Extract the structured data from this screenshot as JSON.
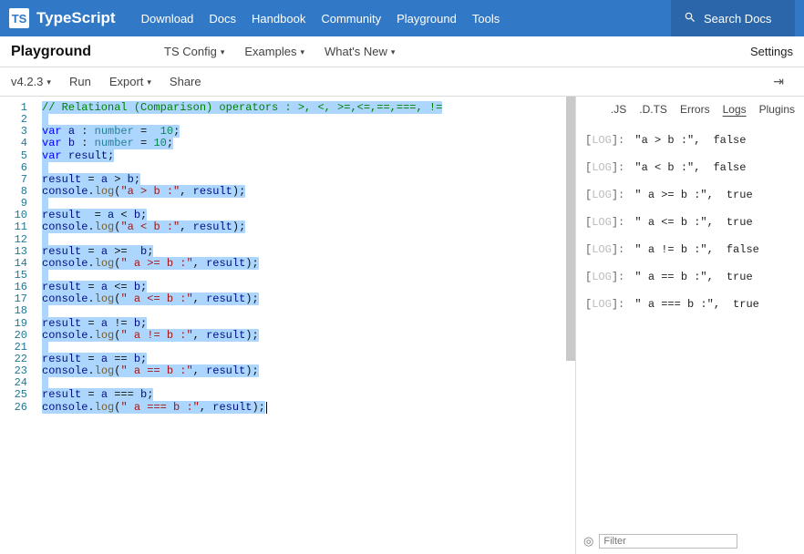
{
  "topbar": {
    "logo_text": "TS",
    "brand": "TypeScript",
    "links": [
      "Download",
      "Docs",
      "Handbook",
      "Community",
      "Playground",
      "Tools"
    ],
    "search_placeholder": "Search Docs"
  },
  "subbar": {
    "page_title": "Playground",
    "items": [
      "TS Config",
      "Examples",
      "What's New"
    ],
    "settings": "Settings"
  },
  "toolbar": {
    "version": "v4.2.3",
    "run": "Run",
    "export": "Export",
    "share": "Share"
  },
  "editor": {
    "lines": [
      {
        "n": 1,
        "tokens": [
          {
            "t": "// Relational (Comparison) operators : >, <, >=,<=,==,===, !=",
            "c": "tok-comment"
          }
        ]
      },
      {
        "n": 2,
        "tokens": []
      },
      {
        "n": 3,
        "tokens": [
          {
            "t": "var",
            "c": "tok-kw"
          },
          {
            "t": " "
          },
          {
            "t": "a",
            "c": "tok-ident"
          },
          {
            "t": " : "
          },
          {
            "t": "number",
            "c": "tok-type"
          },
          {
            "t": " =  "
          },
          {
            "t": "10",
            "c": "tok-num"
          },
          {
            "t": ";"
          }
        ]
      },
      {
        "n": 4,
        "tokens": [
          {
            "t": "var",
            "c": "tok-kw"
          },
          {
            "t": " "
          },
          {
            "t": "b",
            "c": "tok-ident"
          },
          {
            "t": " : "
          },
          {
            "t": "number",
            "c": "tok-type"
          },
          {
            "t": " = "
          },
          {
            "t": "10",
            "c": "tok-num"
          },
          {
            "t": ";"
          }
        ]
      },
      {
        "n": 5,
        "tokens": [
          {
            "t": "var",
            "c": "tok-kw"
          },
          {
            "t": " "
          },
          {
            "t": "result",
            "c": "tok-ident"
          },
          {
            "t": ";"
          }
        ]
      },
      {
        "n": 6,
        "tokens": []
      },
      {
        "n": 7,
        "tokens": [
          {
            "t": "result",
            "c": "tok-ident"
          },
          {
            "t": " = "
          },
          {
            "t": "a",
            "c": "tok-ident"
          },
          {
            "t": " > "
          },
          {
            "t": "b",
            "c": "tok-ident"
          },
          {
            "t": ";"
          }
        ]
      },
      {
        "n": 8,
        "tokens": [
          {
            "t": "console",
            "c": "tok-ident"
          },
          {
            "t": "."
          },
          {
            "t": "log",
            "c": "tok-fn"
          },
          {
            "t": "("
          },
          {
            "t": "\"a > b :\"",
            "c": "tok-str"
          },
          {
            "t": ", "
          },
          {
            "t": "result",
            "c": "tok-ident"
          },
          {
            "t": ");"
          }
        ]
      },
      {
        "n": 9,
        "tokens": []
      },
      {
        "n": 10,
        "tokens": [
          {
            "t": "result",
            "c": "tok-ident"
          },
          {
            "t": "  = "
          },
          {
            "t": "a",
            "c": "tok-ident"
          },
          {
            "t": " < "
          },
          {
            "t": "b",
            "c": "tok-ident"
          },
          {
            "t": ";"
          }
        ]
      },
      {
        "n": 11,
        "tokens": [
          {
            "t": "console",
            "c": "tok-ident"
          },
          {
            "t": "."
          },
          {
            "t": "log",
            "c": "tok-fn"
          },
          {
            "t": "("
          },
          {
            "t": "\"a < b :\"",
            "c": "tok-str"
          },
          {
            "t": ", "
          },
          {
            "t": "result",
            "c": "tok-ident"
          },
          {
            "t": ");"
          }
        ]
      },
      {
        "n": 12,
        "tokens": []
      },
      {
        "n": 13,
        "tokens": [
          {
            "t": "result",
            "c": "tok-ident"
          },
          {
            "t": " = "
          },
          {
            "t": "a",
            "c": "tok-ident"
          },
          {
            "t": " >=  "
          },
          {
            "t": "b",
            "c": "tok-ident"
          },
          {
            "t": ";"
          }
        ]
      },
      {
        "n": 14,
        "tokens": [
          {
            "t": "console",
            "c": "tok-ident"
          },
          {
            "t": "."
          },
          {
            "t": "log",
            "c": "tok-fn"
          },
          {
            "t": "("
          },
          {
            "t": "\" a >= b :\"",
            "c": "tok-str"
          },
          {
            "t": ", "
          },
          {
            "t": "result",
            "c": "tok-ident"
          },
          {
            "t": ");"
          }
        ]
      },
      {
        "n": 15,
        "tokens": []
      },
      {
        "n": 16,
        "tokens": [
          {
            "t": "result",
            "c": "tok-ident"
          },
          {
            "t": " = "
          },
          {
            "t": "a",
            "c": "tok-ident"
          },
          {
            "t": " <= "
          },
          {
            "t": "b",
            "c": "tok-ident"
          },
          {
            "t": ";"
          }
        ]
      },
      {
        "n": 17,
        "tokens": [
          {
            "t": "console",
            "c": "tok-ident"
          },
          {
            "t": "."
          },
          {
            "t": "log",
            "c": "tok-fn"
          },
          {
            "t": "("
          },
          {
            "t": "\" a <= b :\"",
            "c": "tok-str"
          },
          {
            "t": ", "
          },
          {
            "t": "result",
            "c": "tok-ident"
          },
          {
            "t": ");"
          }
        ]
      },
      {
        "n": 18,
        "tokens": []
      },
      {
        "n": 19,
        "tokens": [
          {
            "t": "result",
            "c": "tok-ident"
          },
          {
            "t": " = "
          },
          {
            "t": "a",
            "c": "tok-ident"
          },
          {
            "t": " != "
          },
          {
            "t": "b",
            "c": "tok-ident"
          },
          {
            "t": ";"
          }
        ]
      },
      {
        "n": 20,
        "tokens": [
          {
            "t": "console",
            "c": "tok-ident"
          },
          {
            "t": "."
          },
          {
            "t": "log",
            "c": "tok-fn"
          },
          {
            "t": "("
          },
          {
            "t": "\" a != b :\"",
            "c": "tok-str"
          },
          {
            "t": ", "
          },
          {
            "t": "result",
            "c": "tok-ident"
          },
          {
            "t": ");"
          }
        ]
      },
      {
        "n": 21,
        "tokens": []
      },
      {
        "n": 22,
        "tokens": [
          {
            "t": "result",
            "c": "tok-ident"
          },
          {
            "t": " = "
          },
          {
            "t": "a",
            "c": "tok-ident"
          },
          {
            "t": " == "
          },
          {
            "t": "b",
            "c": "tok-ident"
          },
          {
            "t": ";"
          }
        ]
      },
      {
        "n": 23,
        "tokens": [
          {
            "t": "console",
            "c": "tok-ident"
          },
          {
            "t": "."
          },
          {
            "t": "log",
            "c": "tok-fn"
          },
          {
            "t": "("
          },
          {
            "t": "\" a == b :\"",
            "c": "tok-str"
          },
          {
            "t": ", "
          },
          {
            "t": "result",
            "c": "tok-ident"
          },
          {
            "t": ");"
          }
        ]
      },
      {
        "n": 24,
        "tokens": []
      },
      {
        "n": 25,
        "tokens": [
          {
            "t": "result",
            "c": "tok-ident"
          },
          {
            "t": " = "
          },
          {
            "t": "a",
            "c": "tok-ident"
          },
          {
            "t": " === "
          },
          {
            "t": "b",
            "c": "tok-ident"
          },
          {
            "t": ";"
          }
        ]
      },
      {
        "n": 26,
        "tokens": [
          {
            "t": "console",
            "c": "tok-ident"
          },
          {
            "t": "."
          },
          {
            "t": "log",
            "c": "tok-fn"
          },
          {
            "t": "("
          },
          {
            "t": "\" a === b :\"",
            "c": "tok-str"
          },
          {
            "t": ", "
          },
          {
            "t": "result",
            "c": "tok-ident"
          },
          {
            "t": ");"
          }
        ]
      }
    ]
  },
  "results": {
    "tabs": [
      ".JS",
      ".D.TS",
      "Errors",
      "Logs",
      "Plugins"
    ],
    "active_tab": "Logs",
    "log_label": "LOG",
    "logs": [
      {
        "msg": "\"a > b :\"",
        "val": "false"
      },
      {
        "msg": "\"a < b :\"",
        "val": "false"
      },
      {
        "msg": "\" a >= b :\"",
        "val": "true"
      },
      {
        "msg": "\" a <= b :\"",
        "val": "true"
      },
      {
        "msg": "\" a != b :\"",
        "val": "false"
      },
      {
        "msg": "\" a == b :\"",
        "val": "true"
      },
      {
        "msg": "\" a === b :\"",
        "val": "true"
      }
    ],
    "filter_placeholder": "Filter"
  }
}
